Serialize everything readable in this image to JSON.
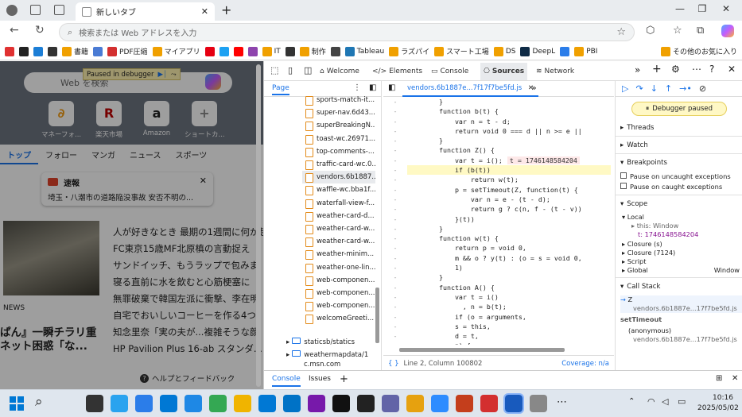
{
  "browser": {
    "tab_title": "新しいタブ",
    "omni_placeholder": "検索または Web アドレスを入力",
    "bookmarks": [
      {
        "label": "",
        "color": "#e03131"
      },
      {
        "label": "",
        "color": "#222"
      },
      {
        "label": "",
        "color": "#1c7ed6"
      },
      {
        "label": "",
        "color": "#333"
      },
      {
        "label": "書籍",
        "color": "#f0a000"
      },
      {
        "label": "",
        "color": "#4a7bd4"
      },
      {
        "label": "PDF圧縮",
        "color": "#d32f2f"
      },
      {
        "label": "マイアプリ",
        "color": "#f0a000"
      },
      {
        "label": "",
        "color": "#e60012"
      },
      {
        "label": "",
        "color": "#1da1f2"
      },
      {
        "label": "",
        "color": "#ff0000"
      },
      {
        "label": "",
        "color": "#8e44ad"
      },
      {
        "label": "IT",
        "color": "#f0a000"
      },
      {
        "label": "",
        "color": "#333"
      },
      {
        "label": "制作",
        "color": "#f0a000"
      },
      {
        "label": "",
        "color": "#444"
      },
      {
        "label": "Tableau",
        "color": "#1f77b4"
      },
      {
        "label": "ラズパイ",
        "color": "#f0a000"
      },
      {
        "label": "スマート工場",
        "color": "#f0a000"
      },
      {
        "label": "DS",
        "color": "#f0a000"
      },
      {
        "label": "DeepL",
        "color": "#0f2b46"
      },
      {
        "label": "",
        "color": "#2b7de9"
      },
      {
        "label": "PBI",
        "color": "#f0a000"
      }
    ],
    "other_favorites": "その他のお気に入り"
  },
  "page": {
    "paused_banner": "Paused in debugger",
    "search_placeholder": "Web を検索",
    "quick_links": [
      {
        "label": "マネーフォ...",
        "color": "#f39c12",
        "glyph": "∂"
      },
      {
        "label": "楽天市場",
        "color": "#bf0000",
        "glyph": "R"
      },
      {
        "label": "Amazon",
        "color": "#222",
        "glyph": "a"
      },
      {
        "label": "ショートカ...",
        "color": "#888",
        "glyph": "+"
      }
    ],
    "nav": [
      "トップ",
      "フォロー",
      "マンガ",
      "ニュース",
      "スポーツ"
    ],
    "alert": {
      "title": "速報",
      "text": "埼玉・八潮市の道路陥没事故 安否不明の..."
    },
    "headlines": [
      "人が好きなとき 最期の1週間に何が起",
      "FC東京15歳MF北原槙の言動捉え",
      "サンドイッチ、もうラップで包みま",
      "寝る直前に水を飲むと心筋梗塞に",
      "無罪破棄で韓国左派に衝撃、李在明",
      "自宅でおいしいコーヒーを作る4つ",
      "知念里奈「実の夫が...複雑そうな顔",
      "HP Pavilion Plus 16-ab スタンダ..."
    ],
    "news_label": "NEWS",
    "feature_title_1": "ぱん』一瞬チラリ重",
    "feature_title_2": "ネット困惑「な...",
    "help_button": "ヘルプとフィードバック"
  },
  "devtools": {
    "tabs": [
      "Welcome",
      "Elements",
      "Console",
      "Sources",
      "Network"
    ],
    "active_tab": "Sources",
    "nav_tab": "Page",
    "files": [
      "sports-match-it...",
      "super-nav.6d43...",
      "superBreakingN...",
      "toast-wc.26971...",
      "top-comments-...",
      "traffic-card-wc.0...",
      "vendors.6b1887...",
      "waffle-wc.bba1f...",
      "waterfall-view-f...",
      "weather-card-d...",
      "weather-card-w...",
      "weather-card-w...",
      "weather-minim...",
      "weather-one-lin...",
      "web-componen...",
      "web-componen...",
      "web-componen...",
      "welcomeGreeti..."
    ],
    "folders": [
      "staticsb/statics",
      "weathermapdata/1"
    ],
    "folder_more": "c.msn.com",
    "editor_tab": "vendors.6b1887e...7f17f7be5fd.js",
    "code": [
      {
        "t": "        }",
        "k": ""
      },
      {
        "t": "        function b(t) {",
        "k": ""
      },
      {
        "t": "            var n = t - d;",
        "k": ""
      },
      {
        "t": "            return void 0 === d || n >= e ||",
        "k": ""
      },
      {
        "t": "        }",
        "k": ""
      },
      {
        "t": "        function Z() {",
        "k": ""
      },
      {
        "t": "            var t = i();",
        "k": "t = 1746148584204"
      },
      {
        "t": "            if (b(t))",
        "k": "hl"
      },
      {
        "t": "                return w(t);",
        "k": ""
      },
      {
        "t": "            p = setTimeout(Z, function(t) {",
        "k": ""
      },
      {
        "t": "                var n = e - (t - d);",
        "k": ""
      },
      {
        "t": "                return g ? c(n, f - (t - v))",
        "k": ""
      },
      {
        "t": "            }(t))",
        "k": ""
      },
      {
        "t": "        }",
        "k": ""
      },
      {
        "t": "        function w(t) {",
        "k": ""
      },
      {
        "t": "            return p = void 0,",
        "k": ""
      },
      {
        "t": "            m && o ? y(t) : (o = s = void 0,",
        "k": ""
      },
      {
        "t": "            1)",
        "k": ""
      },
      {
        "t": "        }",
        "k": ""
      },
      {
        "t": "        function A() {",
        "k": ""
      },
      {
        "t": "            var t = i()",
        "k": ""
      },
      {
        "t": "              , n = b(t);",
        "k": ""
      },
      {
        "t": "            if (o = arguments,",
        "k": ""
      },
      {
        "t": "            s = this,",
        "k": ""
      },
      {
        "t": "            d = t,",
        "k": ""
      },
      {
        "t": "            n) {",
        "k": ""
      }
    ],
    "status_position": "Line 2, Column 100802",
    "status_coverage": "Coverage: n/a",
    "debugger_paused": "Debugger paused",
    "threads": "Threads",
    "watch": "Watch",
    "breakpoints": "Breakpoints",
    "pause_uncaught": "Pause on uncaught exceptions",
    "pause_caught": "Pause on caught exceptions",
    "scope": "Scope",
    "scope_local": "Local",
    "scope_this": "this: Window",
    "scope_t": "t: 1746148584204",
    "scope_closure_s": "Closure (s)",
    "scope_closure_7124": "Closure (7124)",
    "scope_script": "Script",
    "scope_global": "Global",
    "scope_global_val": "Window",
    "call_stack": "Call Stack",
    "cs_1_name": "Z",
    "cs_1_file": "vendors.6b1887e...17f7be5fd.js",
    "cs_2_name": "setTimeout",
    "cs_3_name": "(anonymous)",
    "cs_3_file": "vendors.6b1887e...17f7be5fd.js",
    "drawer_tabs": [
      "Console",
      "Issues"
    ]
  },
  "taskbar": {
    "time": "10:16",
    "date": "2025/05/02",
    "apps": [
      "#0078d4",
      "#333",
      "#2aa3ef",
      "#2b7de9",
      "#0078d4",
      "#1e88e5",
      "#34a853",
      "#f0b400",
      "#0078d4",
      "#0072c6",
      "#7719aa",
      "#111",
      "#222",
      "#6264a7",
      "#e6a10f",
      "#2d8cff",
      "#c43e1c",
      "#d32f2f",
      "#185abd",
      "#888",
      "#1e90ff"
    ]
  }
}
